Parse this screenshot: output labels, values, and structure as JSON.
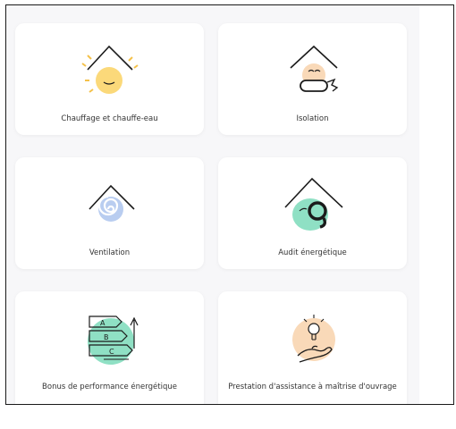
{
  "cards": [
    {
      "label": "Chauffage et chauffe-eau",
      "icon": "sun-house-icon"
    },
    {
      "label": "Isolation",
      "icon": "insulation-house-icon"
    },
    {
      "label": "Ventilation",
      "icon": "ventilation-house-icon"
    },
    {
      "label": "Audit énergétique",
      "icon": "audit-magnifier-house-icon"
    },
    {
      "label": "Bonus de performance énergétique",
      "icon": "energy-rating-icon"
    },
    {
      "label": "Prestation d'assistance à maîtrise d'ouvrage",
      "icon": "lightbulb-hand-icon"
    }
  ],
  "colors": {
    "yellow": "#fbd97a",
    "peach": "#f9d9b8",
    "mint": "#8fe0c4",
    "blue": "#b9cdf0",
    "line": "#1b1b1b"
  }
}
